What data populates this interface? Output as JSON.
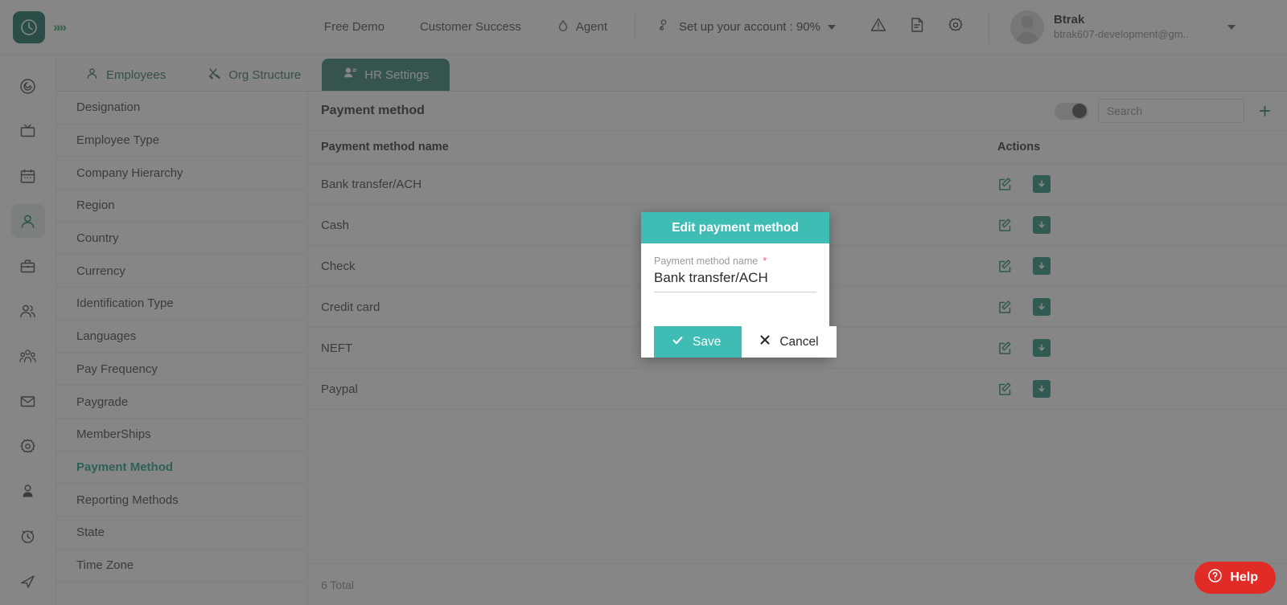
{
  "header": {
    "logo_icon": "clock-logo-icon",
    "expand_icon": "double-chevron-right-icon",
    "nav": [
      {
        "label": "Free Demo",
        "icon": null
      },
      {
        "label": "Customer Success",
        "icon": null
      },
      {
        "label": "Agent",
        "icon": "agent-drop-icon"
      }
    ],
    "account_setup": {
      "label": "Set up your account : 90%",
      "icon": "person-settings-icon"
    },
    "icons": [
      "warning-triangle-icon",
      "document-icon",
      "gear-icon"
    ],
    "user": {
      "name": "Btrak",
      "email": "btrak607-development@gm..",
      "avatar": "avatar"
    }
  },
  "rail": {
    "items": [
      {
        "name": "target-icon",
        "active": false
      },
      {
        "name": "monitor-icon",
        "active": false
      },
      {
        "name": "calendar-icon",
        "active": false
      },
      {
        "name": "person-icon",
        "active": true
      },
      {
        "name": "briefcase-icon",
        "active": false
      },
      {
        "name": "two-people-icon",
        "active": false
      },
      {
        "name": "group-people-icon",
        "active": false
      },
      {
        "name": "mail-icon",
        "active": false
      },
      {
        "name": "gear-icon",
        "active": false
      },
      {
        "name": "user-circle-icon",
        "active": false
      },
      {
        "name": "alarm-clock-icon",
        "active": false
      },
      {
        "name": "send-icon",
        "active": false
      }
    ]
  },
  "tabs": [
    {
      "label": "Employees",
      "icon": "person-icon",
      "active": false
    },
    {
      "label": "Org Structure",
      "icon": "tools-icon",
      "active": false
    },
    {
      "label": "HR Settings",
      "icon": "people-gear-icon",
      "active": true
    }
  ],
  "settings_list": [
    {
      "label": "Designation",
      "active": false
    },
    {
      "label": "Employee Type",
      "active": false
    },
    {
      "label": "Company Hierarchy",
      "active": false
    },
    {
      "label": "Region",
      "active": false
    },
    {
      "label": "Country",
      "active": false
    },
    {
      "label": "Currency",
      "active": false
    },
    {
      "label": "Identification Type",
      "active": false
    },
    {
      "label": "Languages",
      "active": false
    },
    {
      "label": "Pay Frequency",
      "active": false
    },
    {
      "label": "Paygrade",
      "active": false
    },
    {
      "label": "MemberShips",
      "active": false
    },
    {
      "label": "Payment Method",
      "active": true
    },
    {
      "label": "Reporting Methods",
      "active": false
    },
    {
      "label": "State",
      "active": false
    },
    {
      "label": "Time Zone",
      "active": false
    }
  ],
  "content": {
    "title": "Payment method",
    "search_placeholder": "Search",
    "search_value": "",
    "add_label": "+",
    "columns": [
      "Payment method name",
      "Actions"
    ],
    "rows": [
      {
        "name": "Bank transfer/ACH"
      },
      {
        "name": "Cash"
      },
      {
        "name": "Check"
      },
      {
        "name": "Credit card"
      },
      {
        "name": "NEFT"
      },
      {
        "name": "Paypal"
      }
    ],
    "total": "6 Total"
  },
  "modal": {
    "title": "Edit payment method",
    "field_label": "Payment method name",
    "required_mark": "*",
    "field_value": "Bank transfer/ACH",
    "save_label": "Save",
    "cancel_label": "Cancel"
  },
  "help": {
    "label": "Help",
    "icon": "question-circle-icon"
  },
  "colors": {
    "brand_dark_teal": "#0e6b5c",
    "tab_active": "#2e7d6d",
    "modal_teal": "#3fbdb5",
    "accent_green": "#179e7e",
    "help_red": "#e02b27",
    "required_pink": "#ef5f7a"
  }
}
